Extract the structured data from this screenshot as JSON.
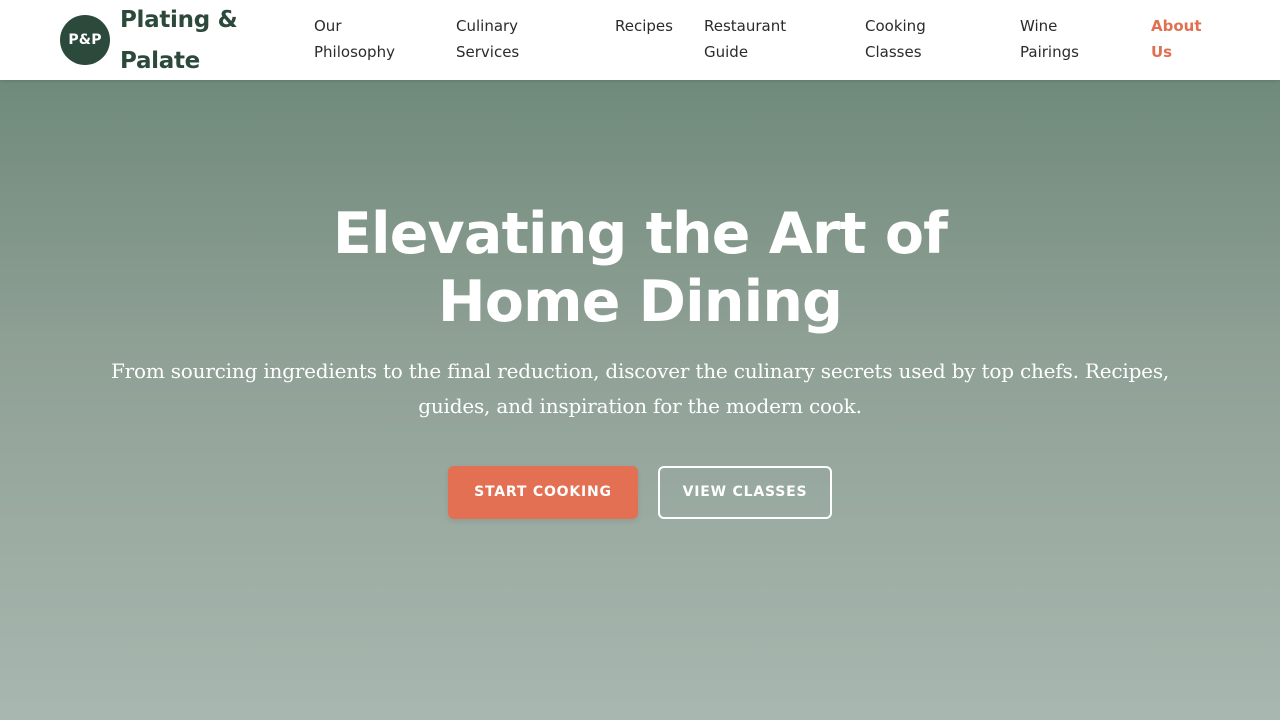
{
  "brand": {
    "badge": "P&P",
    "name": "Plating & Palate"
  },
  "nav": {
    "items": [
      {
        "label": "Our Philosophy"
      },
      {
        "label": "Culinary Services"
      },
      {
        "label": "Recipes"
      },
      {
        "label": "Restaurant Guide"
      },
      {
        "label": "Cooking Classes"
      },
      {
        "label": "Wine Pairings"
      },
      {
        "label": "About Us",
        "active": true
      }
    ]
  },
  "hero": {
    "title": "Elevating the Art of Home Dining",
    "subtitle": "From sourcing ingredients to the final reduction, discover the culinary secrets used by top chefs. Recipes, guides, and inspiration for the modern cook.",
    "primary_cta": "START COOKING",
    "secondary_cta": "VIEW CLASSES"
  },
  "colors": {
    "brand_green": "#2c4a3b",
    "accent": "#e37052",
    "hero_top": "#6f8a7b",
    "hero_bottom": "#a8b8b0"
  }
}
